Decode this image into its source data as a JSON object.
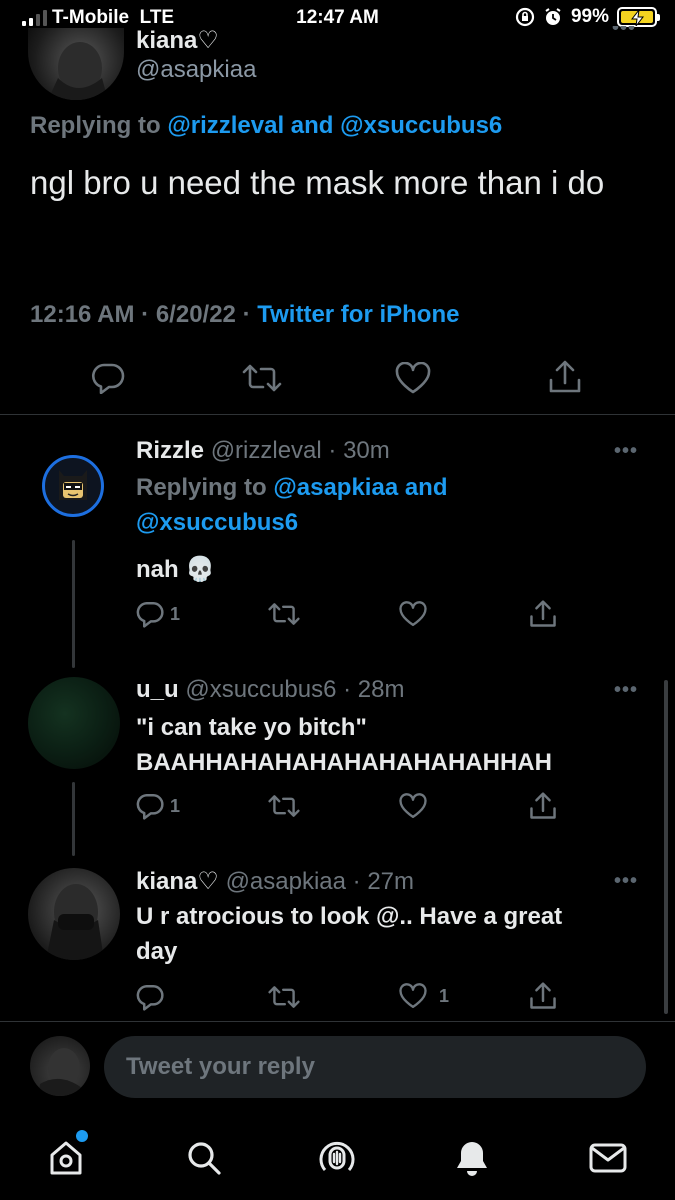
{
  "status_bar": {
    "carrier": "T-Mobile",
    "network": "LTE",
    "time": "12:47 AM",
    "battery": "99%"
  },
  "main_tweet": {
    "name": "kiana♡",
    "handle": "@asapkiaa",
    "replying_prefix": "Replying to",
    "replying_to": "@rizzleval and @xsuccubus6",
    "text": "ngl bro u need the mask more than i do",
    "time": "12:16 AM",
    "date": "6/20/22",
    "source": "Twitter for iPhone",
    "icons": [
      "reply-icon",
      "retweet-icon",
      "like-icon",
      "share-icon"
    ]
  },
  "replies": [
    {
      "name": "Rizzle",
      "handle": "@rizzleval",
      "age": "30m",
      "replying_line1": "Replying to @asapkiaa and",
      "replying_line2": "@xsuccubus6",
      "text": "nah 💀",
      "reply_count": "1",
      "like_count": ""
    },
    {
      "name": "u_u",
      "handle": "@xsuccubus6",
      "age": "28m",
      "text_line1": "\"i can take yo bitch\"",
      "text_line2": "BAAHHAHAHAHAHAHAHAHAHHAH",
      "reply_count": "1",
      "like_count": ""
    },
    {
      "name": "kiana♡",
      "handle": "@asapkiaa",
      "age": "27m",
      "text_line1": "U r atrocious to look @.. Have a great",
      "text_line2": "day",
      "reply_count": "",
      "like_count": "1"
    }
  ],
  "compose": {
    "placeholder": "Tweet your reply"
  },
  "tabbar": {
    "items": [
      "home-icon",
      "search-icon",
      "spaces-icon",
      "notifications-icon",
      "messages-icon"
    ]
  },
  "colors": {
    "accent": "#1d9bf0",
    "background": "#000000",
    "muted": "#6e767d",
    "battery": "#f4d320"
  }
}
